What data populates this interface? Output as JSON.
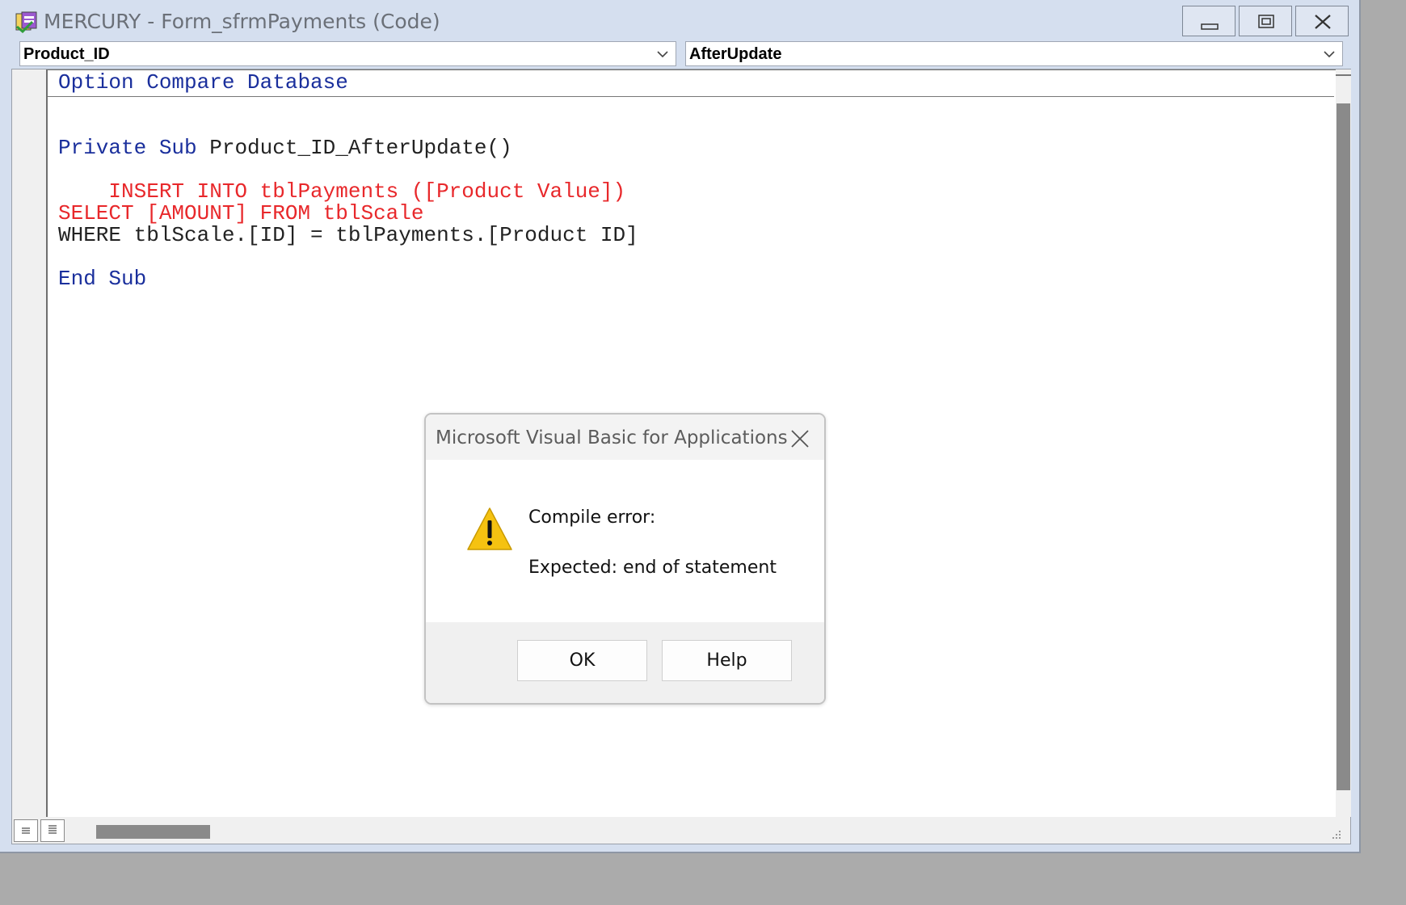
{
  "window": {
    "title": "MERCURY - Form_sfrmPayments (Code)",
    "icon": "vba-project-icon"
  },
  "combos": {
    "object": "Product_ID",
    "procedure": "AfterUpdate"
  },
  "code": {
    "line1": "Option Compare Database",
    "line2_kw": "Private Sub",
    "line2_rest": " Product_ID_AfterUpdate()",
    "line3": "    INSERT INTO tblPayments ([Product Value])",
    "line4": "SELECT [AMOUNT] FROM tblScale",
    "line5": "WHERE tblScale.[ID] = tblPayments.[Product ID]",
    "line6": "End Sub"
  },
  "dialog": {
    "title": "Microsoft Visual Basic for Applications",
    "message1": "Compile error:",
    "message2": "Expected: end of statement",
    "ok_label": "OK",
    "help_label": "Help",
    "icon": "warning-icon"
  },
  "colors": {
    "keyword": "#1a2f9c",
    "error": "#e8282b"
  }
}
